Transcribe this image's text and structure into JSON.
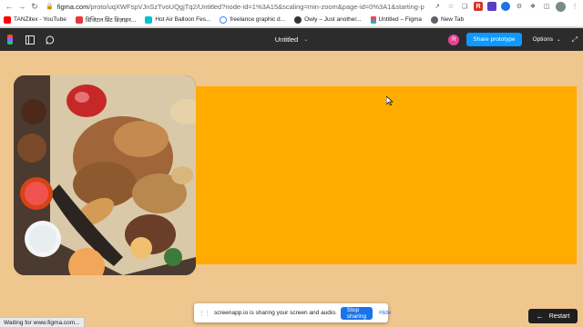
{
  "browser": {
    "url_host": "figma.com",
    "url_path": "/proto/uqXWFspVJnSzTvoUQgjTq2/Untitled?node-id=1%3A15&scaling=min-zoom&page-id=0%3A1&starting-point-...",
    "back_icon": "arrow-left-icon",
    "forward_icon": "arrow-right-icon",
    "reload_icon": "reload-icon"
  },
  "bookmarks": [
    {
      "label": "TANZitex - YouTube",
      "icon": "youtube-icon"
    },
    {
      "label": "डिजिटल प्रिंट डिज़ाइन...",
      "icon": "pdf-icon"
    },
    {
      "label": "Hot Air Balloon Fes...",
      "icon": "canva-icon"
    },
    {
      "label": "freelance graphic d...",
      "icon": "google-icon"
    },
    {
      "label": "Owly – Just another...",
      "icon": "owly-icon"
    },
    {
      "label": "Untitled – Figma",
      "icon": "figma-icon"
    },
    {
      "label": "New Tab",
      "icon": "globe-icon"
    }
  ],
  "figma": {
    "file_title": "Untitled",
    "avatar_initial": "R",
    "share_label": "Share prototype",
    "options_label": "Options"
  },
  "canvas": {
    "frame_color": "#ffab00",
    "background_color": "#f0c68f"
  },
  "status": {
    "text": "Waiting for www.figma.com..."
  },
  "screenshare": {
    "message": "screenapp.io is sharing your screen and audio.",
    "stop_label": "Stop sharing",
    "hide_label": "Hide"
  },
  "restart": {
    "label": "Restart"
  }
}
